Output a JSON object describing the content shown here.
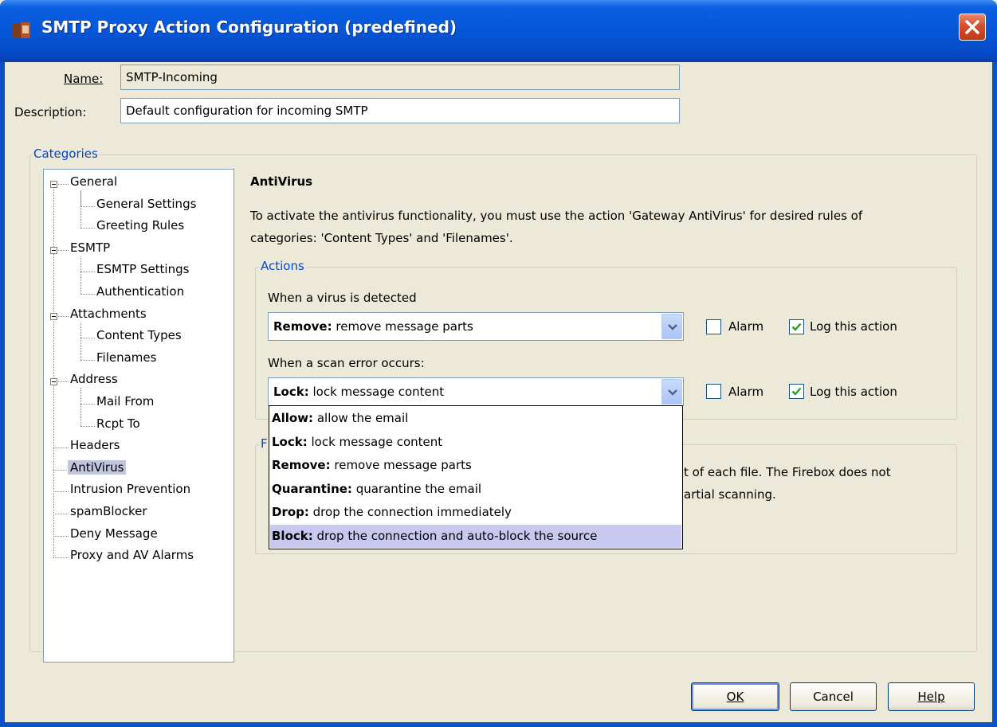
{
  "window": {
    "title": "SMTP Proxy Action Configuration (predefined)"
  },
  "form": {
    "name_label": "Name:",
    "name_value": "SMTP-Incoming",
    "description_label": "Description:",
    "description_value": "Default configuration for incoming SMTP"
  },
  "categories": {
    "legend": "Categories",
    "tree": [
      {
        "label": "General",
        "level": 0,
        "expanded": true
      },
      {
        "label": "General Settings",
        "level": 1
      },
      {
        "label": "Greeting Rules",
        "level": 1
      },
      {
        "label": "ESMTP",
        "level": 0,
        "expanded": true
      },
      {
        "label": "ESMTP Settings",
        "level": 1
      },
      {
        "label": "Authentication",
        "level": 1
      },
      {
        "label": "Attachments",
        "level": 0,
        "expanded": true
      },
      {
        "label": "Content Types",
        "level": 1
      },
      {
        "label": "Filenames",
        "level": 1
      },
      {
        "label": "Address",
        "level": 0,
        "expanded": true
      },
      {
        "label": "Mail From",
        "level": 1
      },
      {
        "label": "Rcpt To",
        "level": 1
      },
      {
        "label": "Headers",
        "level": 0
      },
      {
        "label": "AntiVirus",
        "level": 0,
        "selected": true
      },
      {
        "label": "Intrusion Prevention",
        "level": 0
      },
      {
        "label": "spamBlocker",
        "level": 0
      },
      {
        "label": "Deny Message",
        "level": 0
      },
      {
        "label": "Proxy and AV Alarms",
        "level": 0
      }
    ]
  },
  "antivirus": {
    "heading": "AntiVirus",
    "intro_line1": "To activate the antivirus functionality, you must use the action 'Gateway AntiVirus' for desired rules of",
    "intro_line2": "categories: 'Content Types' and 'Filenames'.",
    "actions_legend": "Actions",
    "virus_label": "When a virus is detected",
    "virus_select": {
      "bold": "Remove:",
      "text": " remove message parts"
    },
    "virus_alarm_label": "Alarm",
    "virus_alarm_checked": false,
    "virus_log_label": "Log this action",
    "virus_log_checked": true,
    "error_label": "When a scan error occurs:",
    "error_select": {
      "bold": "Lock:",
      "text": " lock message content"
    },
    "error_alarm_label": "Alarm",
    "error_alarm_checked": false,
    "error_log_label": "Log this action",
    "error_log_checked": true,
    "second_group_legend_fragment": "F",
    "partial_text_line1": "t of each file. The Firebox does not",
    "partial_text_line2": "artial scanning."
  },
  "dropdown_options": [
    {
      "bold": "Allow:",
      "text": " allow the email"
    },
    {
      "bold": "Lock:",
      "text": " lock message content"
    },
    {
      "bold": "Remove:",
      "text": " remove message parts"
    },
    {
      "bold": "Quarantine:",
      "text": " quarantine the email"
    },
    {
      "bold": "Drop:",
      "text": " drop the connection immediately"
    },
    {
      "bold": "Block:",
      "text": " drop the connection and auto-block the source",
      "highlighted": true
    }
  ],
  "buttons": {
    "ok": "OK",
    "cancel": "Cancel",
    "help": "Help"
  },
  "colors": {
    "titlebar": "#0656d8",
    "legend": "#0046d5",
    "selection": "#c1c5dd",
    "dropdown_highlight": "#c8c8f0"
  }
}
